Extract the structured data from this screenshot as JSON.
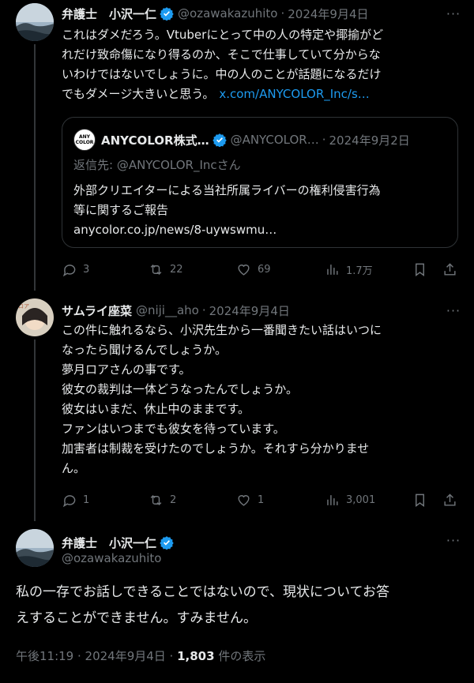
{
  "tweet1": {
    "name": "弁護士　小沢一仁",
    "handle": "@ozawakazuhito",
    "date": "2024年9月4日",
    "lines": [
      "これはダメだろう。Vtuberにとって中の人の特定や揶揄がど",
      "れだけ致命傷になり得るのか、そこで仕事していて分からな",
      "いわけではないでしょうに。中の人のことが話題になるだけ",
      "でもダメージ大きいと思う。"
    ],
    "link": "x.com/ANYCOLOR_Inc/s…",
    "quote": {
      "logo_line1": "ANY",
      "logo_line2": "COLOR",
      "name": "ANYCOLOR株式…",
      "handle": "@ANYCOLOR…",
      "date": "2024年9月2日",
      "reply_to": "返信先: @ANYCOLOR_Incさん",
      "lines": [
        "外部クリエイターによる当社所属ライバーの権利侵害行為",
        "等に関するご報告"
      ],
      "url": "anycolor.co.jp/news/8-uywswmu…"
    },
    "actions": {
      "replies": "3",
      "reposts": "22",
      "likes": "69",
      "views": "1.7万"
    }
  },
  "tweet2": {
    "name": "サムライ座菜",
    "handle": "@niji__aho",
    "date": "2024年9月4日",
    "lines": [
      "この件に触れるなら、小沢先生から一番聞きたい話はいつに",
      "なったら聞けるんでしょうか。",
      "夢月ロアさんの事です。",
      "彼女の裁判は一体どうなったんでしょうか。",
      "彼女はいまだ、休止中のままです。",
      "ファンはいつまでも彼女を待っています。",
      "加害者は制裁を受けたのでしょうか。それすら分かりませ",
      "ん。"
    ],
    "actions": {
      "replies": "1",
      "reposts": "2",
      "likes": "1",
      "views": "3,001"
    }
  },
  "tweet3": {
    "name": "弁護士　小沢一仁",
    "handle": "@ozawakazuhito",
    "lines": [
      "私の一存でお話しできることではないので、現状についてお答",
      "えすることができません。すみません。"
    ],
    "time": "午後11:19 · 2024年9月4日 · ",
    "views_count": "1,803",
    "views_label": " 件の表示"
  },
  "colors": {
    "accent": "#1d9bf0",
    "muted": "#71767b",
    "text": "#e7e9ea",
    "background": "#000000"
  }
}
